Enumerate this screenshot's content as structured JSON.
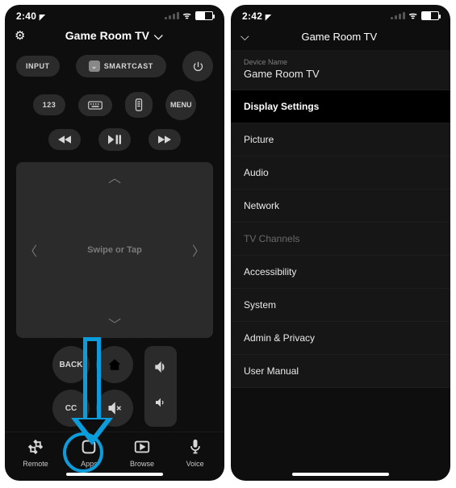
{
  "left": {
    "status": {
      "time": "2:40",
      "loc_arrow": "➤"
    },
    "header": {
      "title": "Game Room TV"
    },
    "buttons": {
      "input": "INPUT",
      "smartcast": "SMARTCAST",
      "power": "⏻",
      "k123": "123",
      "keyboard": "⌨",
      "list": "▤",
      "menu": "MENU",
      "rw": "◀◀",
      "playpause": "▶||",
      "ff": "▶▶",
      "back": "BACK",
      "home": "⌂",
      "cc": "CC",
      "mute": "🔇",
      "vol_up": "🔊",
      "vol_down": "🔉"
    },
    "touchpad": {
      "caption": "Swipe or Tap"
    },
    "nav": {
      "remote": "Remote",
      "apps": "Apps",
      "browse": "Browse",
      "voice": "Voice"
    }
  },
  "right": {
    "status": {
      "time": "2:42",
      "loc_arrow": "➤"
    },
    "header": {
      "title": "Game Room TV"
    },
    "device": {
      "label": "Device Name",
      "name": "Game Room TV"
    },
    "rows": {
      "display_settings": "Display Settings",
      "picture": "Picture",
      "audio": "Audio",
      "network": "Network",
      "tv_channels": "TV Channels",
      "accessibility": "Accessibility",
      "system": "System",
      "admin_privacy": "Admin & Privacy",
      "user_manual": "User Manual"
    }
  }
}
